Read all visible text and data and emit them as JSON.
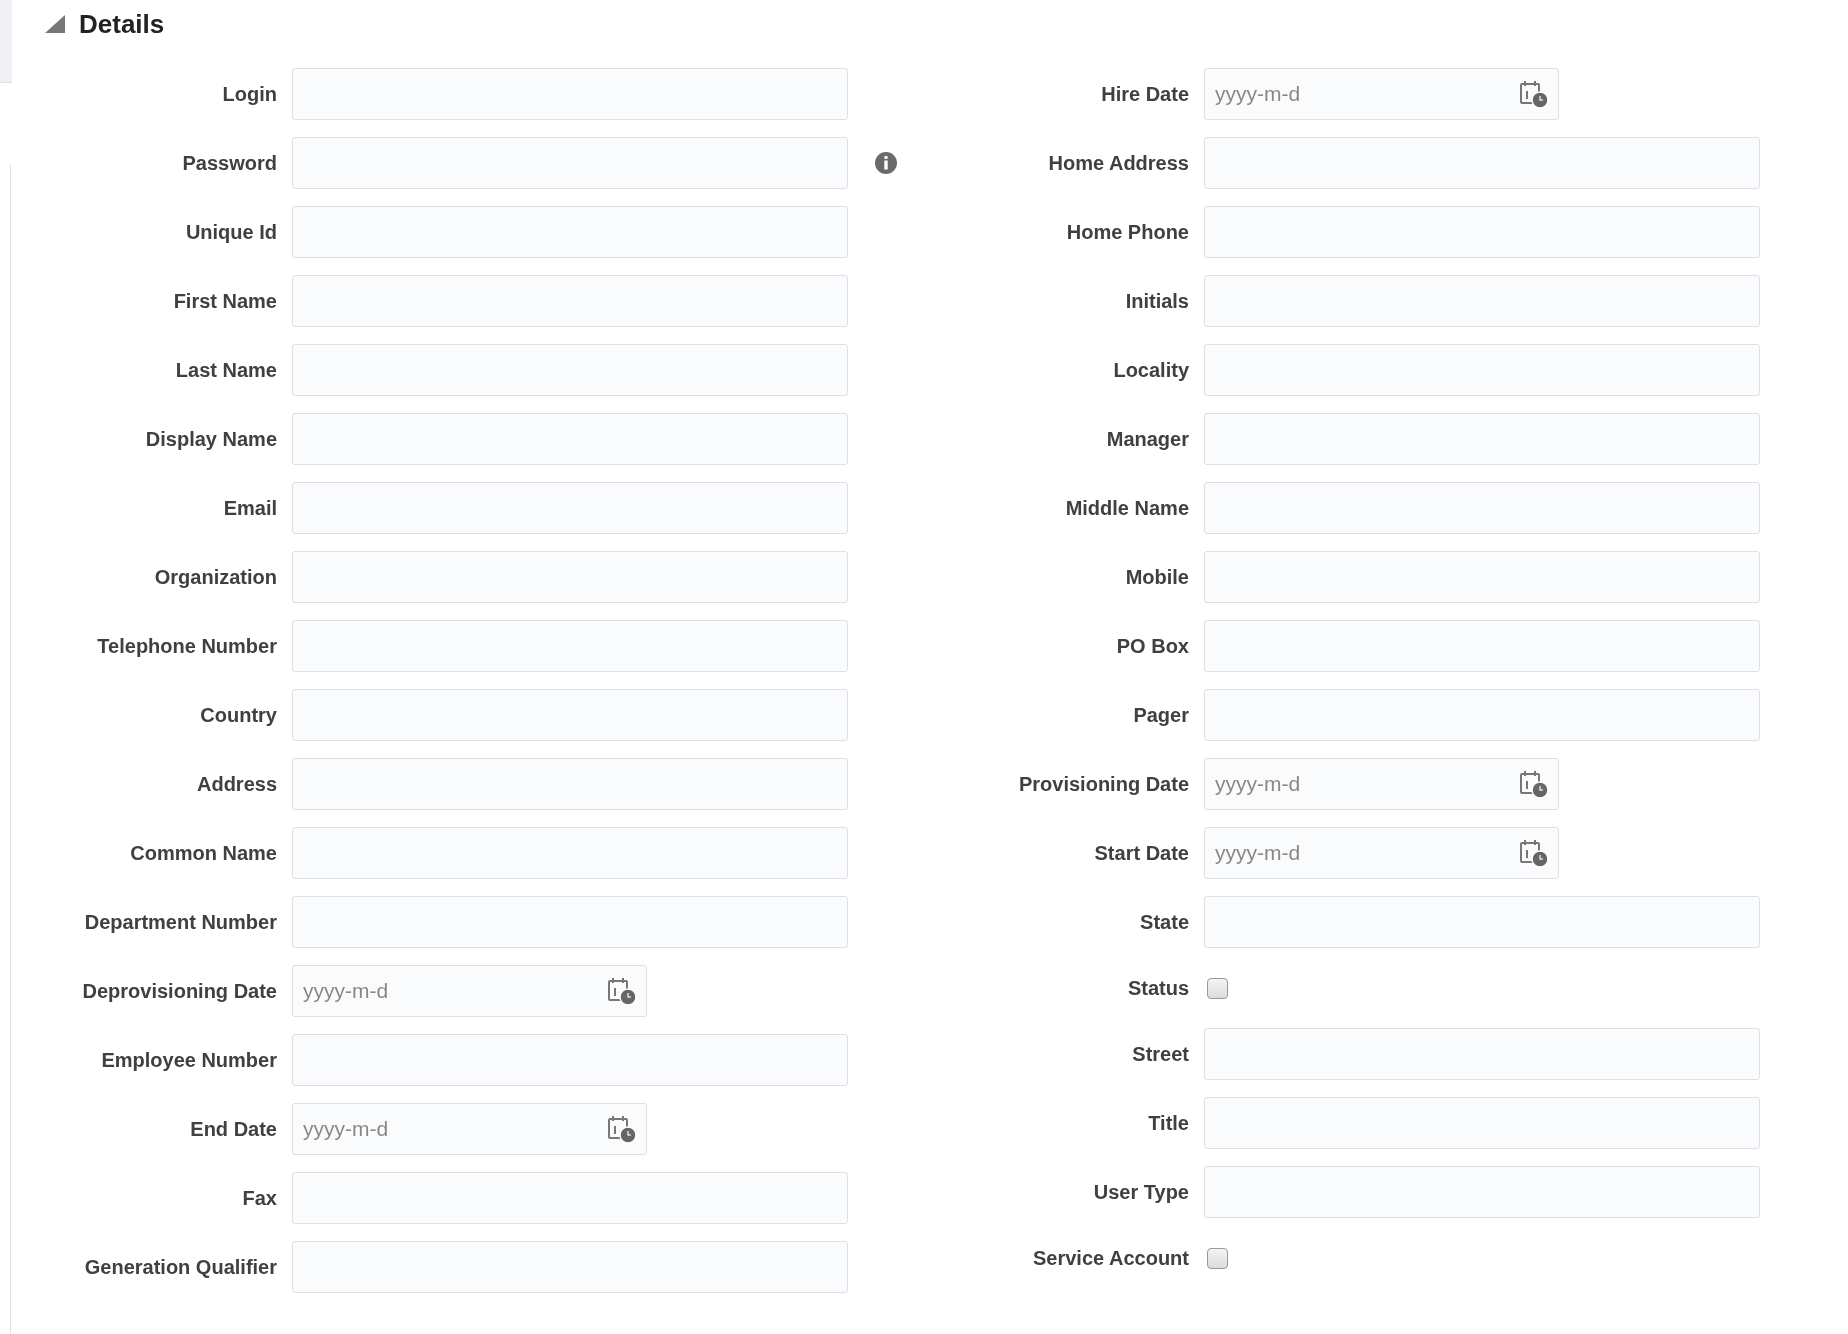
{
  "section": {
    "title": "Details",
    "expanded": true
  },
  "left_fields": [
    {
      "label": "Login",
      "kind": "text"
    },
    {
      "label": "Password",
      "kind": "text-info"
    },
    {
      "label": "Unique Id",
      "kind": "text"
    },
    {
      "label": "First Name",
      "kind": "text"
    },
    {
      "label": "Last Name",
      "kind": "text"
    },
    {
      "label": "Display Name",
      "kind": "text"
    },
    {
      "label": "Email",
      "kind": "text"
    },
    {
      "label": "Organization",
      "kind": "text"
    },
    {
      "label": "Telephone Number",
      "kind": "text"
    },
    {
      "label": "Country",
      "kind": "text"
    },
    {
      "label": "Address",
      "kind": "text"
    },
    {
      "label": "Common Name",
      "kind": "text"
    },
    {
      "label": "Department Number",
      "kind": "text"
    },
    {
      "label": "Deprovisioning Date",
      "kind": "date",
      "placeholder": "yyyy-m-d"
    },
    {
      "label": "Employee Number",
      "kind": "text"
    },
    {
      "label": "End Date",
      "kind": "date",
      "placeholder": "yyyy-m-d"
    },
    {
      "label": "Fax",
      "kind": "text"
    },
    {
      "label": "Generation Qualifier",
      "kind": "text"
    }
  ],
  "right_fields": [
    {
      "label": "Hire Date",
      "kind": "date",
      "placeholder": "yyyy-m-d"
    },
    {
      "label": "Home Address",
      "kind": "text"
    },
    {
      "label": "Home Phone",
      "kind": "text"
    },
    {
      "label": "Initials",
      "kind": "text"
    },
    {
      "label": "Locality",
      "kind": "text"
    },
    {
      "label": "Manager",
      "kind": "text"
    },
    {
      "label": "Middle Name",
      "kind": "text"
    },
    {
      "label": "Mobile",
      "kind": "text"
    },
    {
      "label": "PO Box",
      "kind": "text"
    },
    {
      "label": "Pager",
      "kind": "text"
    },
    {
      "label": "Provisioning Date",
      "kind": "date",
      "placeholder": "yyyy-m-d"
    },
    {
      "label": "Start Date",
      "kind": "date",
      "placeholder": "yyyy-m-d"
    },
    {
      "label": "State",
      "kind": "text"
    },
    {
      "label": "Status",
      "kind": "checkbox",
      "checked": false
    },
    {
      "label": "Street",
      "kind": "text"
    },
    {
      "label": "Title",
      "kind": "text"
    },
    {
      "label": "User Type",
      "kind": "text"
    },
    {
      "label": "Service Account",
      "kind": "checkbox",
      "checked": false
    }
  ]
}
